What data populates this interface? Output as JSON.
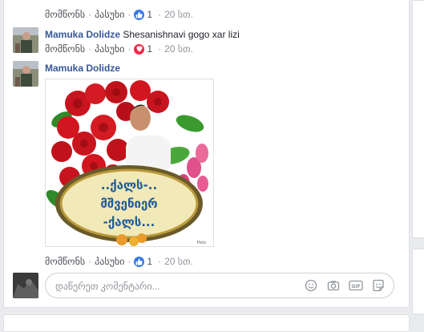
{
  "comments": [
    {
      "actions": {
        "like": "მომწონს",
        "reply": "პასუხი"
      },
      "reaction": {
        "type": "like",
        "count": "1"
      },
      "time": "20 სთ."
    },
    {
      "author": "Mamuka Dolidze",
      "text": "Shesanishnavi gogo xar lizi",
      "actions": {
        "like": "მომწონს",
        "reply": "პასუხი"
      },
      "reaction": {
        "type": "love",
        "count": "1"
      },
      "time": "20 სთ."
    },
    {
      "author": "Mamuka Dolidze",
      "image": {
        "caption_lines": [
          "..ქალს-..",
          "მშვენიერ",
          "-ქალს..."
        ],
        "watermark": "Pixiz"
      },
      "actions": {
        "like": "მომწონს",
        "reply": "პასუხი"
      },
      "reaction": {
        "type": "like",
        "count": "1"
      },
      "time": "20 სთ."
    }
  ],
  "composer": {
    "placeholder": "დაწერეთ კომენტარი...",
    "tools": [
      "emoji-icon",
      "camera-icon",
      "gif-icon",
      "sticker-icon"
    ]
  },
  "colors": {
    "link": "#365899",
    "like": "#3578e5",
    "love": "#f0284a",
    "meta": "#90949c"
  }
}
